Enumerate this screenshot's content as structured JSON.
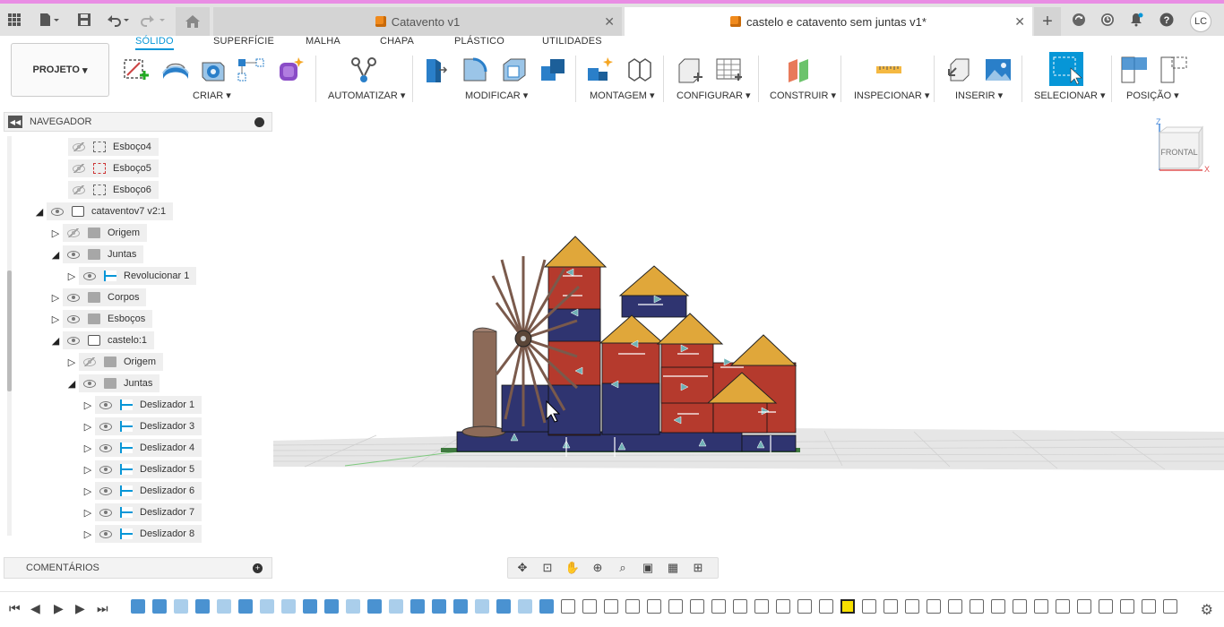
{
  "topbar": {
    "tabs": [
      {
        "label": "Catavento v1",
        "active": false
      },
      {
        "label": "castelo e catavento sem juntas v1*",
        "active": true
      }
    ],
    "avatar": "LC"
  },
  "ribbon": {
    "tabs": [
      "SÓLIDO",
      "SUPERFÍCIE",
      "MALHA",
      "CHAPA",
      "PLÁSTICO",
      "UTILIDADES"
    ],
    "active_tab": "SÓLIDO",
    "projeto": "PROJETO",
    "groups": [
      "CRIAR",
      "AUTOMATIZAR",
      "MODIFICAR",
      "MONTAGEM",
      "CONFIGURAR",
      "CONSTRUIR",
      "INSPECIONAR",
      "INSERIR",
      "SELECIONAR",
      "POSIÇÃO"
    ]
  },
  "navigator": {
    "title": "NAVEGADOR",
    "items": [
      {
        "label": "Esboço4",
        "type": "sketch",
        "visible": false
      },
      {
        "label": "Esboço5",
        "type": "sketch-error",
        "visible": false
      },
      {
        "label": "Esboço6",
        "type": "sketch",
        "visible": false
      },
      {
        "label": "cataventov7 v2:1",
        "type": "component",
        "visible": true,
        "expanded": true
      },
      {
        "label": "Origem",
        "type": "folder",
        "visible": false,
        "expanded": false
      },
      {
        "label": "Juntas",
        "type": "folder",
        "visible": true,
        "expanded": true
      },
      {
        "label": "Revolucionar 1",
        "type": "joint-rev",
        "visible": true,
        "expanded": false
      },
      {
        "label": "Corpos",
        "type": "folder",
        "visible": true,
        "expanded": false
      },
      {
        "label": "Esboços",
        "type": "folder",
        "visible": true,
        "expanded": false
      },
      {
        "label": "castelo:1",
        "type": "component",
        "visible": true,
        "expanded": true
      },
      {
        "label": "Origem",
        "type": "folder",
        "visible": false,
        "expanded": false
      },
      {
        "label": "Juntas",
        "type": "folder",
        "visible": true,
        "expanded": true
      },
      {
        "label": "Deslizador 1",
        "type": "joint",
        "visible": true,
        "expanded": false
      },
      {
        "label": "Deslizador 3",
        "type": "joint",
        "visible": true,
        "expanded": false
      },
      {
        "label": "Deslizador 4",
        "type": "joint",
        "visible": true,
        "expanded": false
      },
      {
        "label": "Deslizador 5",
        "type": "joint",
        "visible": true,
        "expanded": false
      },
      {
        "label": "Deslizador 6",
        "type": "joint",
        "visible": true,
        "expanded": false
      },
      {
        "label": "Deslizador 7",
        "type": "joint",
        "visible": true,
        "expanded": false
      },
      {
        "label": "Deslizador 8",
        "type": "joint",
        "visible": true,
        "expanded": false
      }
    ]
  },
  "comments": {
    "title": "COMENTÁRIOS"
  },
  "viewcube": {
    "face": "FRONTAL",
    "axis_z": "Z",
    "axis_x": "X"
  },
  "colors": {
    "accent": "#0696d7",
    "roof": "#e0a73a",
    "brick": "#b53a2d",
    "navy": "#2f3470",
    "wood": "#8c6a58"
  }
}
